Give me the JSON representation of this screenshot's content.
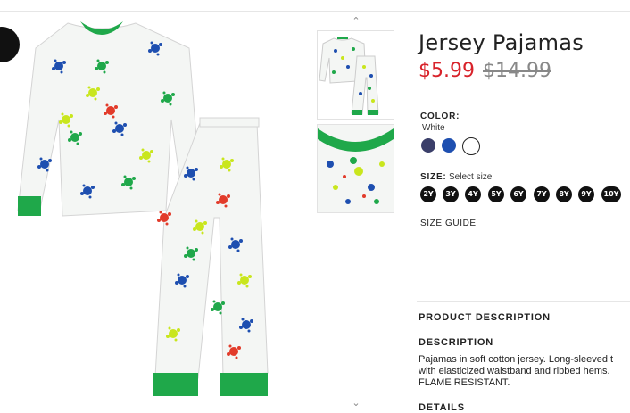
{
  "product": {
    "title": "Jersey Pajamas",
    "price_current": "$5.99",
    "price_original": "$14.99"
  },
  "color": {
    "label": "COLOR:",
    "selected": "White",
    "swatches": [
      {
        "name": "navy",
        "hex": "#3b3f6a"
      },
      {
        "name": "blue",
        "hex": "#1e4fb0"
      },
      {
        "name": "white",
        "hex": "#ffffff"
      }
    ]
  },
  "size": {
    "label": "SIZE:",
    "placeholder": "Select size",
    "options": [
      "2Y",
      "3Y",
      "4Y",
      "5Y",
      "6Y",
      "7Y",
      "8Y",
      "9Y",
      "10Y"
    ]
  },
  "size_guide": "SIZE GUIDE",
  "description": {
    "section_title": "PRODUCT DESCRIPTION",
    "heading": "DESCRIPTION",
    "lines": [
      "Pajamas in soft cotton jersey. Long-sleeved t",
      "with elasticized waistband and ribbed hems.",
      "FLAME RESISTANT."
    ]
  },
  "details_heading": "DETAILS",
  "gallery": {
    "up_arrow": "chevron-up-icon",
    "down_arrow": "chevron-down-icon"
  },
  "colors": {
    "price_sale": "#d8222a",
    "trim_green": "#1fa84a"
  }
}
